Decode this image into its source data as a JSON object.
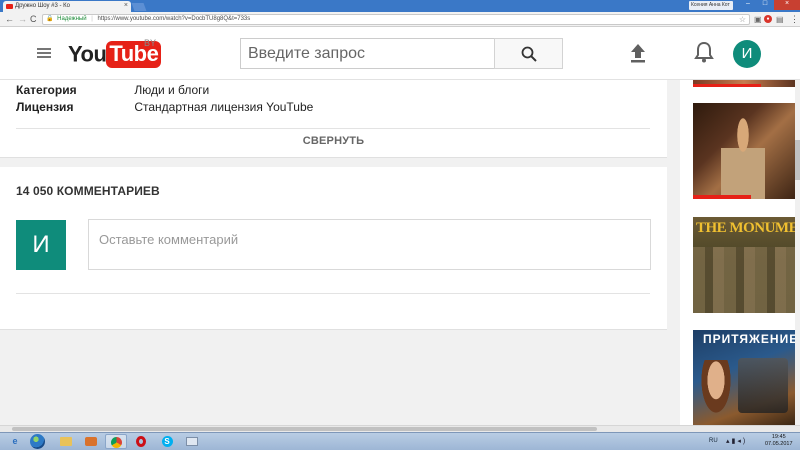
{
  "browser": {
    "tab_title": "Дружно Шоу #3 - Ко",
    "tab_close": "×",
    "profile_name": "Ксения Анна Кот",
    "win_min": "–",
    "win_max": "□",
    "win_close": "×",
    "nav_back": "←",
    "nav_forward": "→",
    "nav_reload": "C",
    "secure_label": "Надежный",
    "url": "https://www.youtube.com/watch?v=DocbTU8g8Q&t=733s",
    "star": "☆",
    "menu": "⋮"
  },
  "header": {
    "logo_you": "You",
    "logo_tube": "Tube",
    "region": "BY",
    "search_placeholder": "Введите запрос",
    "avatar_letter": "И"
  },
  "meta": {
    "category_label": "Категория",
    "category_value": "Люди и блоги",
    "license_label": "Лицензия",
    "license_value": "Стандартная лицензия YouTube",
    "collapse_label": "СВЕРНУТЬ"
  },
  "comments": {
    "title": "14 050 КОММЕНТАРИЕВ",
    "avatar_letter": "И",
    "input_placeholder": "Оставьте комментарий"
  },
  "sidebar": {
    "thumb_2_title": "THE MONUMENTS",
    "thumb_3_title": "ПРИТЯЖЕНИЕ"
  },
  "taskbar": {
    "lang": "RU",
    "time": "19:45",
    "date": "07.05.2017",
    "skype_letter": "S",
    "ie_letter": "e"
  },
  "colors": {
    "brand_red": "#e62117",
    "avatar_teal": "#0f8c7b",
    "secure_green": "#1a8a36"
  }
}
